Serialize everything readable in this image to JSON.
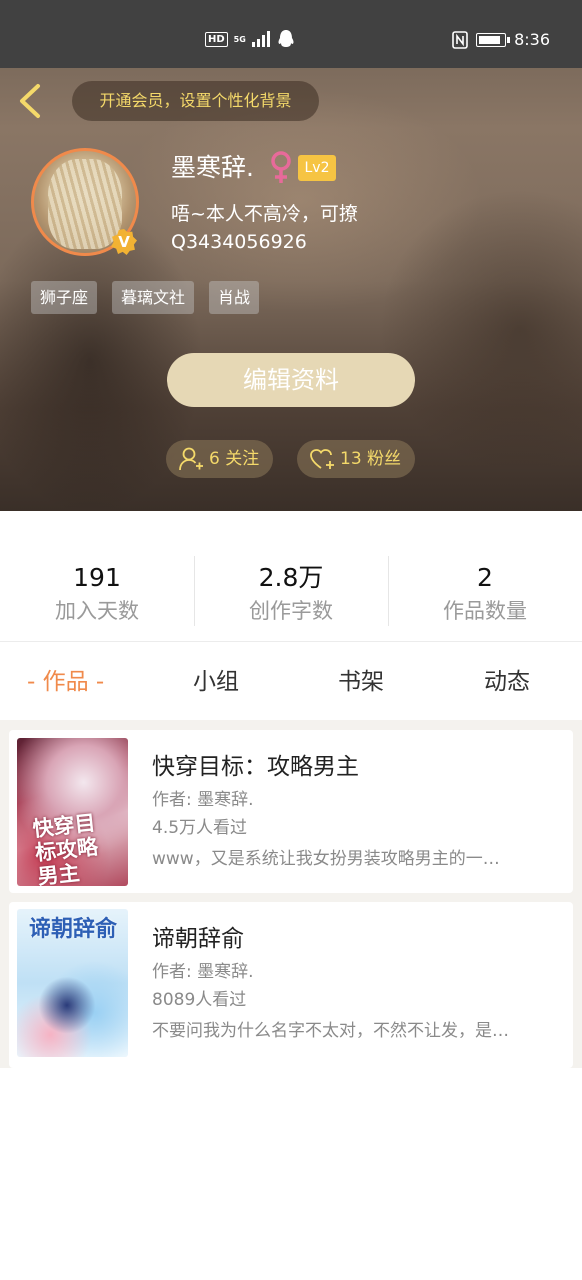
{
  "status_bar": {
    "left_badges": [
      "HD",
      "5G"
    ],
    "time": "8:36",
    "battery_level": 0.75
  },
  "header": {
    "vip_banner": "开通会员，设置个性化背景",
    "nickname": "墨寒辞.",
    "gender": "female",
    "level": "Lv2",
    "verified_badge": "V",
    "bio": "唔~本人不高冷，可撩",
    "qq": "Q3434056926",
    "tags": [
      "狮子座",
      "暮璃文社",
      "肖战"
    ],
    "edit_button": "编辑资料",
    "follow_label": "6 关注",
    "fans_label": "13 粉丝"
  },
  "stats": [
    {
      "value": "191",
      "label": "加入天数"
    },
    {
      "value": "2.8万",
      "label": "创作字数"
    },
    {
      "value": "2",
      "label": "作品数量"
    }
  ],
  "tabs": [
    {
      "label": "- 作品 -",
      "active": true
    },
    {
      "label": "小组",
      "active": false
    },
    {
      "label": "书架",
      "active": false
    },
    {
      "label": "动态",
      "active": false
    }
  ],
  "works": [
    {
      "title": "快穿目标：攻略男主",
      "author": "作者: 墨寒辞.",
      "views": "4.5万人看过",
      "description": "www，又是系统让我女扮男装攻略男主的一…",
      "cover_text": "快穿目标攻略男主"
    },
    {
      "title": "谛朝辞俞",
      "author": "作者: 墨寒辞.",
      "views": "8089人看过",
      "description": "不要问我为什么名字不太对，不然不让发，是…",
      "cover_text": "谛朝辞俞"
    }
  ],
  "colors": {
    "accent": "#f08a4b",
    "gold": "#f4d96a",
    "level_badge": "#f6c443",
    "edit_button": "#e6d8b5"
  }
}
